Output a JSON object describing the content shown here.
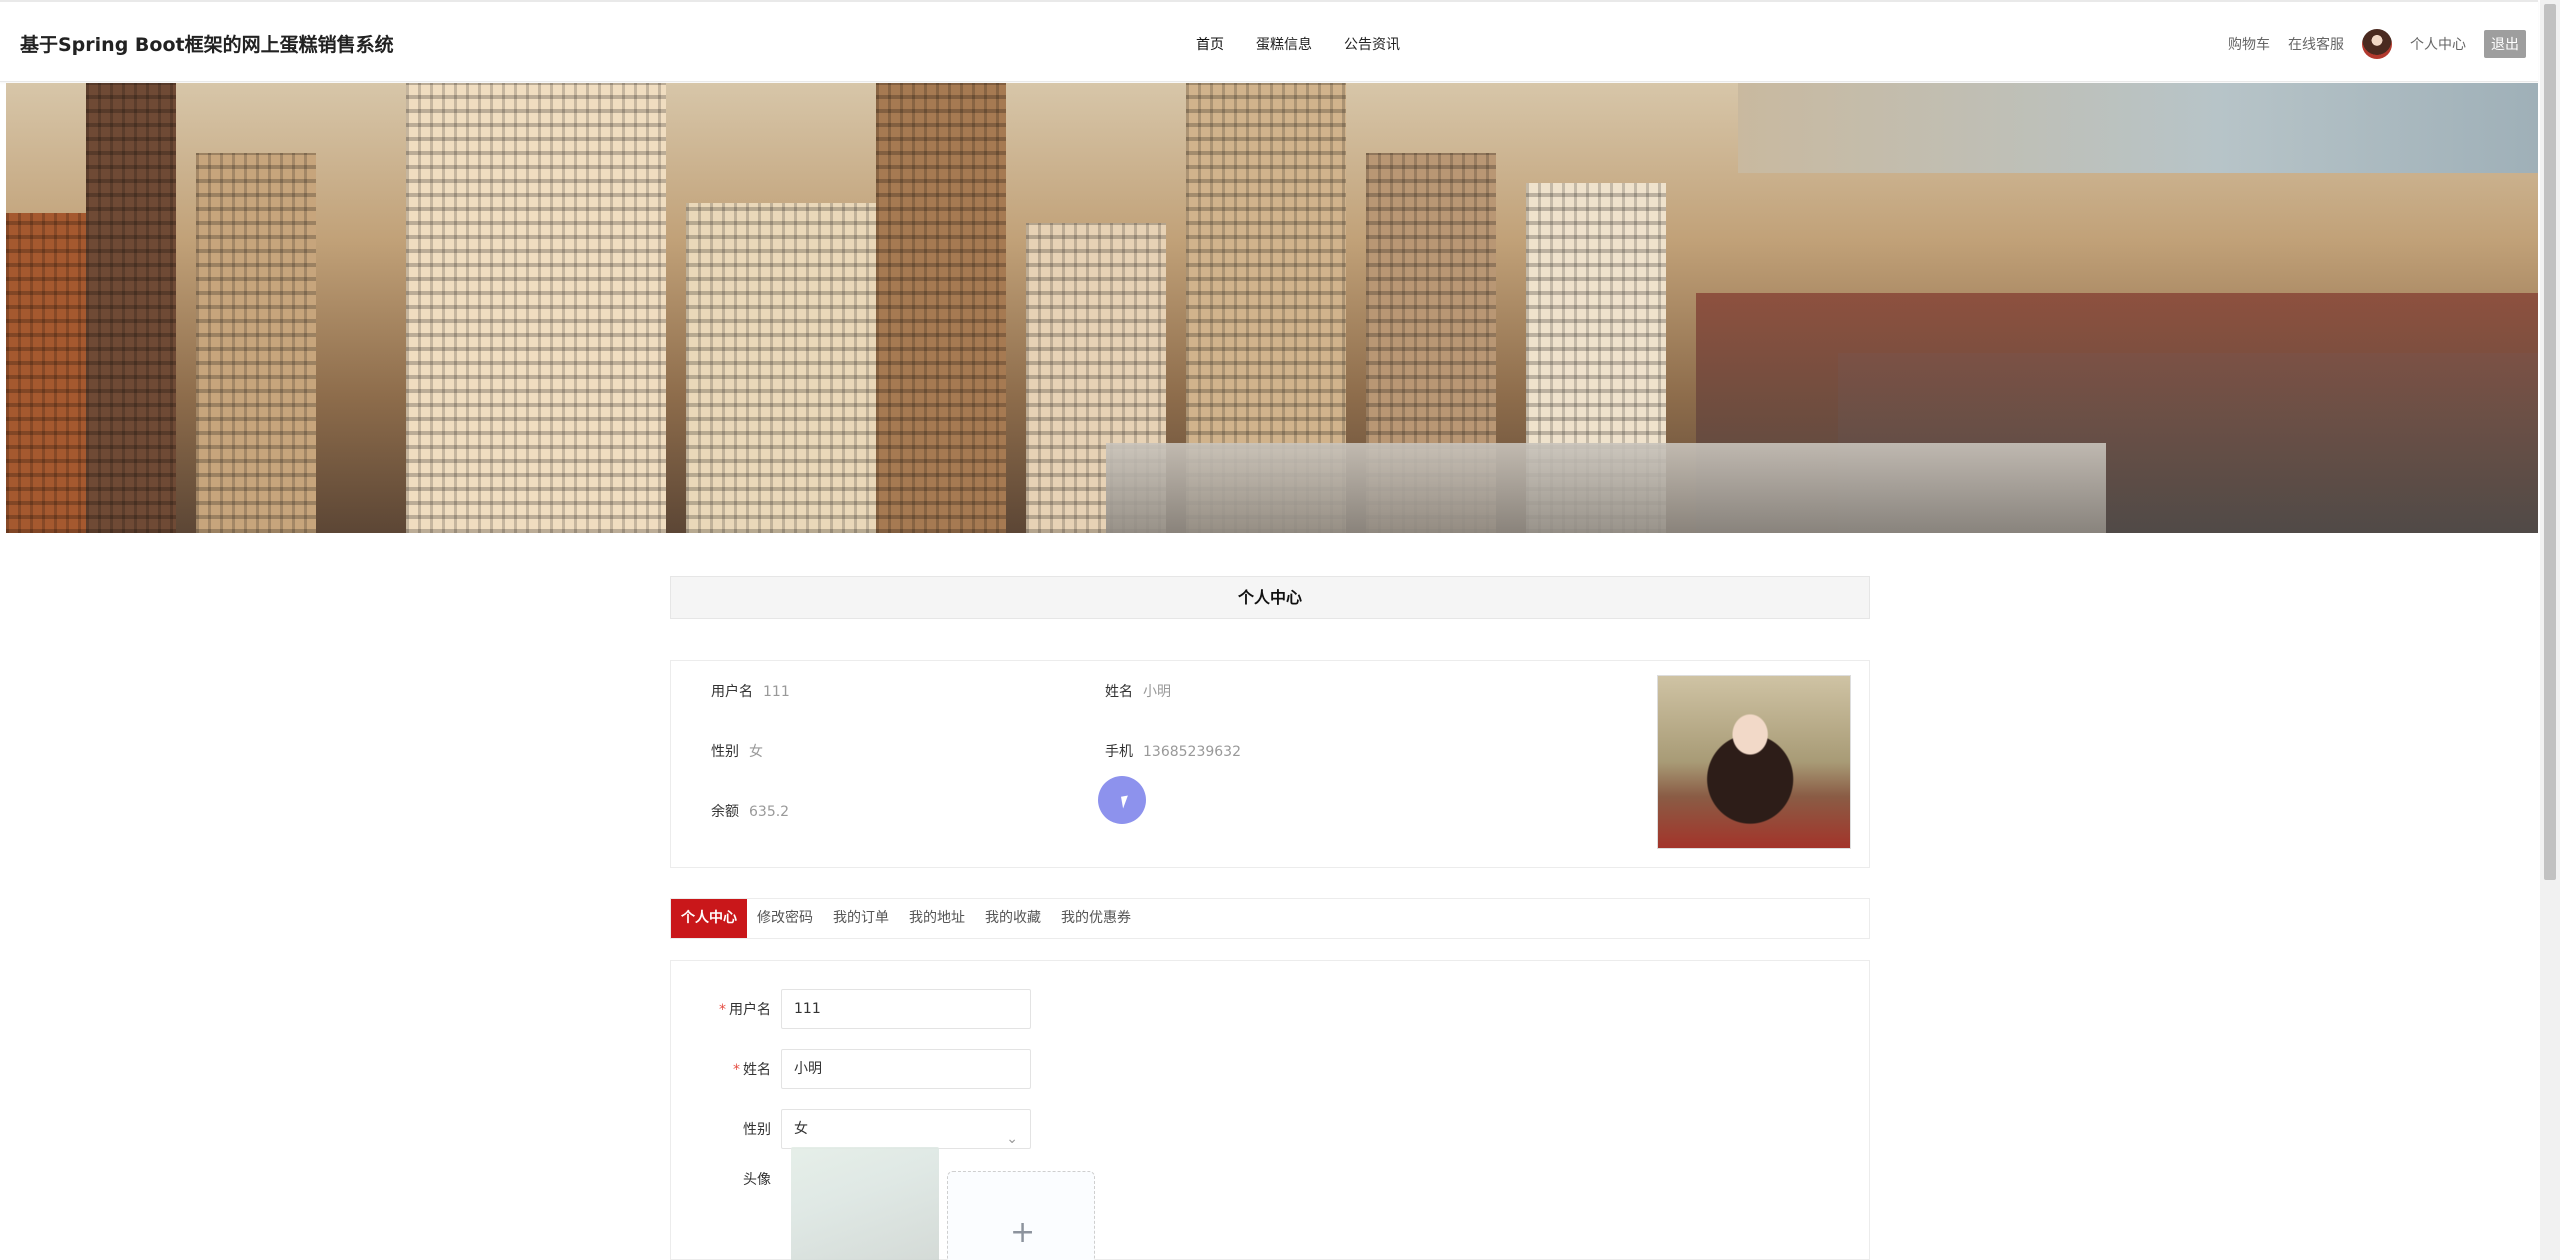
{
  "header": {
    "site_title": "基于Spring Boot框架的网上蛋糕销售系统",
    "nav": [
      "首页",
      "蛋糕信息",
      "公告资讯"
    ],
    "cart": "购物车",
    "service": "在线客服",
    "profile": "个人中心",
    "logout": "退出"
  },
  "panel": {
    "title": "个人中心"
  },
  "info": {
    "username_label": "用户名",
    "username_value": "111",
    "name_label": "姓名",
    "name_value": "小明",
    "gender_label": "性别",
    "gender_value": "女",
    "phone_label": "手机",
    "phone_value": "13685239632",
    "balance_label": "余额",
    "balance_value": "635.2"
  },
  "tabs": [
    "个人中心",
    "修改密码",
    "我的订单",
    "我的地址",
    "我的收藏",
    "我的优惠券"
  ],
  "form": {
    "required_mark": "*",
    "username_label": "用户名",
    "username_value": "111",
    "name_label": "姓名",
    "name_value": "小明",
    "gender_label": "性别",
    "gender_value": "女",
    "avatar_label": "头像",
    "upload_plus": "+"
  },
  "icons": {
    "select_chevron": "chevron-down-icon",
    "upload": "plus-icon"
  },
  "colors": {
    "active_tab": "#c9171a",
    "logout_bg": "#9e9e9e",
    "cursor": "#5c64e6"
  }
}
